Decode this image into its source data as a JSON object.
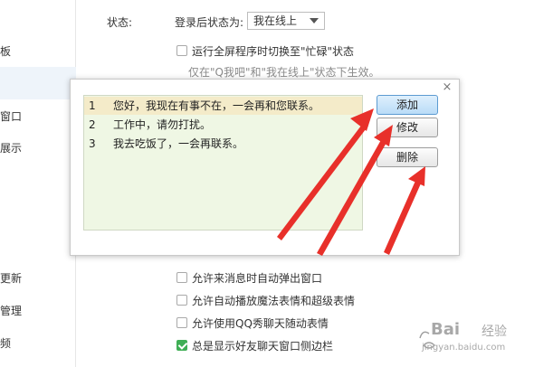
{
  "sidebar": {
    "items": [
      {
        "label": "板",
        "active": false
      },
      {
        "label": "",
        "active": true
      },
      {
        "label": "窗口",
        "active": false
      },
      {
        "label": "展示",
        "active": false
      },
      {
        "label": "更新",
        "active": false
      },
      {
        "label": "管理",
        "active": false
      },
      {
        "label": "频",
        "active": false
      }
    ]
  },
  "status": {
    "label": "状态:",
    "after_login_label": "登录后状态为:",
    "selected": "我在线上",
    "fullscreen_busy": "运行全屏程序时切换至\"忙碌\"状态",
    "hint": "仅在\"Q我吧\"和\"我在线上\"状态下生效。"
  },
  "options": [
    {
      "label": "允许来消息时自动弹出窗口",
      "checked": false
    },
    {
      "label": "允许自动播放魔法表情和超级表情",
      "checked": false
    },
    {
      "label": "允许使用QQ秀聊天随动表情",
      "checked": false
    },
    {
      "label": "总是显示好友聊天窗口侧边栏",
      "checked": true
    }
  ],
  "dialog": {
    "close": "×",
    "replies": [
      {
        "num": "1",
        "text": "您好，我现在有事不在，一会再和您联系。"
      },
      {
        "num": "2",
        "text": "工作中，请勿打扰。"
      },
      {
        "num": "3",
        "text": "我去吃饭了，一会再联系。"
      }
    ],
    "selected_index": 0,
    "add_label": "添加",
    "edit_label": "修改",
    "delete_label": "删除"
  },
  "watermark": {
    "brand": "Bai",
    "brand2": "经验",
    "url": "jingyan.baidu.com"
  },
  "colors": {
    "arrow": "#e8302a",
    "list_bg": "#eff7e4",
    "selected_row": "#f4ebc9",
    "primary_button": "#b9dcf7",
    "checked": "#3fae55"
  }
}
